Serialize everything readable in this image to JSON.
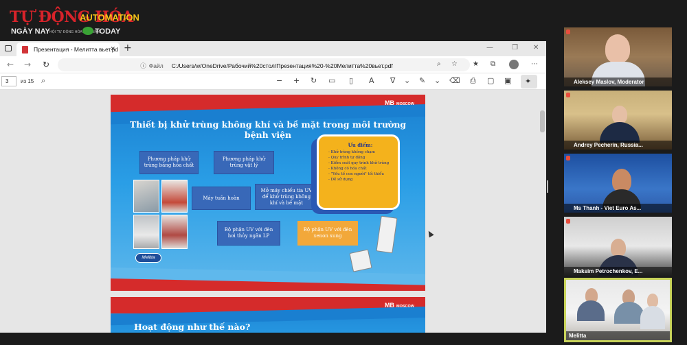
{
  "logo": {
    "line1": "TỰ ĐỘNG HÓA",
    "line1_suffix": "AUTOMATION",
    "line2_left": "NGÀY NAY",
    "line2_tag": "HỘI TỰ ĐỘNG HÓA VIỆT NAM",
    "line2_right": "TODAY"
  },
  "browser": {
    "tab_title": "Презентация - Мелитта вьет.pd",
    "address_label": "Файл",
    "address_url": "C:/Users/w/OneDrive/Рабочий%20стол/Презентация%20-%20Мелитта%20вьет.pdf",
    "page_number": "3",
    "page_of": "из 15"
  },
  "slide1": {
    "brand": "MOSCOW",
    "brand_mark": "MB",
    "title": "Thiết bị khử trùng không khí và bề mặt trong môi trường bệnh viện",
    "box_chem": "Phương pháp khử trùng bằng hóa chất",
    "box_phys": "Phương pháp khử trùng vật lý",
    "box_recirc": "Máy tuần hoàn",
    "box_uv": "Mở máy chiếu tia UV để khử trùng không khí và bề mặt",
    "box_lp": "Bộ phận UV với đèn hơi thủy ngân LP",
    "box_xenon": "Bộ phận UV với đèn xenon xung",
    "adv_header": "Ưu điểm:",
    "adv_items": [
      "- Khử trùng không chạm",
      "- Quy trình tự động",
      "- Kiểm soát quy trình khử trùng",
      "- Không có hóa chất",
      "- \"Yếu tố con người\" tối thiểu",
      "- Dễ sử dụng"
    ],
    "melitta_logo": "Melitta"
  },
  "slide2": {
    "brand": "MOSCOW",
    "brand_mark": "MB",
    "title": "Hoạt động như thế nào?"
  },
  "participants": [
    {
      "name": "Aleksey Maslov, Moderator"
    },
    {
      "name": "Andrey Pecherin, Russia..."
    },
    {
      "name": "Ms Thanh - Viet Euro As..."
    },
    {
      "name": "Maksim Petrochenkov, E..."
    },
    {
      "name": "Melitta"
    }
  ]
}
